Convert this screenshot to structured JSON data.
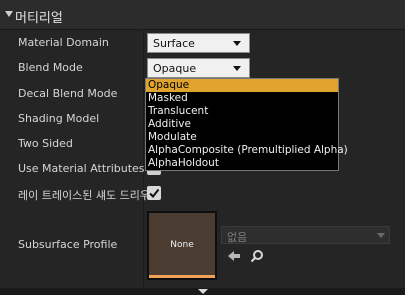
{
  "header": {
    "title": "머티리얼"
  },
  "properties": [
    {
      "label": "Material Domain",
      "value": "Surface"
    },
    {
      "label": "Blend Mode",
      "value": "Opaque"
    },
    {
      "label": "Decal Blend Mode"
    },
    {
      "label": "Shading Model"
    },
    {
      "label": "Two Sided"
    },
    {
      "label": "Use Material Attributes"
    },
    {
      "label": "레이 트레이스된 섀도 드리우"
    },
    {
      "label": "Subsurface Profile"
    }
  ],
  "blend_mode_dropdown": {
    "options": [
      "Opaque",
      "Masked",
      "Translucent",
      "Additive",
      "Modulate",
      "AlphaComposite (Premultiplied Alpha)",
      "AlphaHoldout"
    ],
    "selected": "Opaque"
  },
  "subsurface_profile": {
    "thumbnail_label": "None",
    "asset_value": "없음",
    "icons": [
      "arrow-left-icon",
      "search-icon"
    ]
  },
  "colors": {
    "highlight": "#e0a32d",
    "thumbnail_accent": "#f0a057"
  }
}
